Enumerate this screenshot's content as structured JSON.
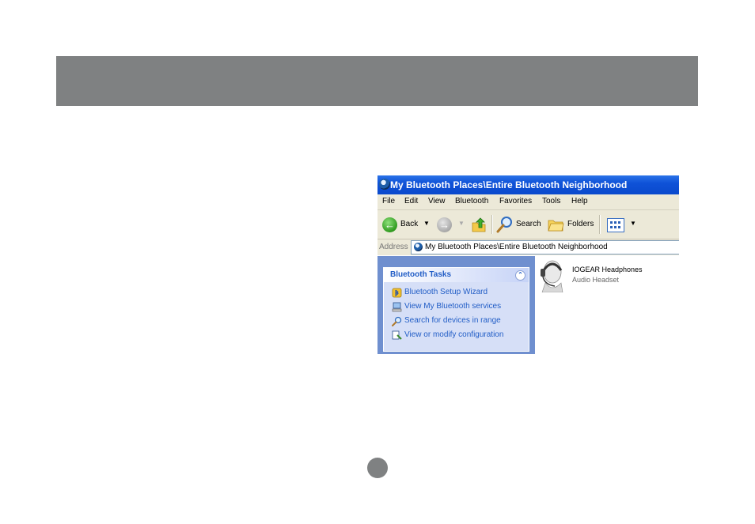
{
  "window": {
    "title": "My Bluetooth Places\\Entire Bluetooth Neighborhood"
  },
  "menu": [
    "File",
    "Edit",
    "View",
    "Bluetooth",
    "Favorites",
    "Tools",
    "Help"
  ],
  "toolbar": {
    "back_label": "Back",
    "search_label": "Search",
    "folders_label": "Folders"
  },
  "address": {
    "label": "Address",
    "value": "My Bluetooth Places\\Entire Bluetooth Neighborhood"
  },
  "tasks": {
    "header": "Bluetooth Tasks",
    "items": [
      {
        "label": "Bluetooth Setup Wizard",
        "icon": "bluetooth-wizard-icon"
      },
      {
        "label": "View My Bluetooth services",
        "icon": "computer-icon"
      },
      {
        "label": "Search for devices in range",
        "icon": "magnifier-icon"
      },
      {
        "label": "View or modify configuration",
        "icon": "configuration-icon"
      }
    ]
  },
  "devices": [
    {
      "name": "IOGEAR Headphones",
      "type": "Audio Headset",
      "icon": "headset-icon"
    }
  ],
  "colors": {
    "header_band": "#7f8182",
    "title_bar": "#0a49cc",
    "task_pane": "#6f8fcf",
    "task_link": "#215dc6"
  }
}
